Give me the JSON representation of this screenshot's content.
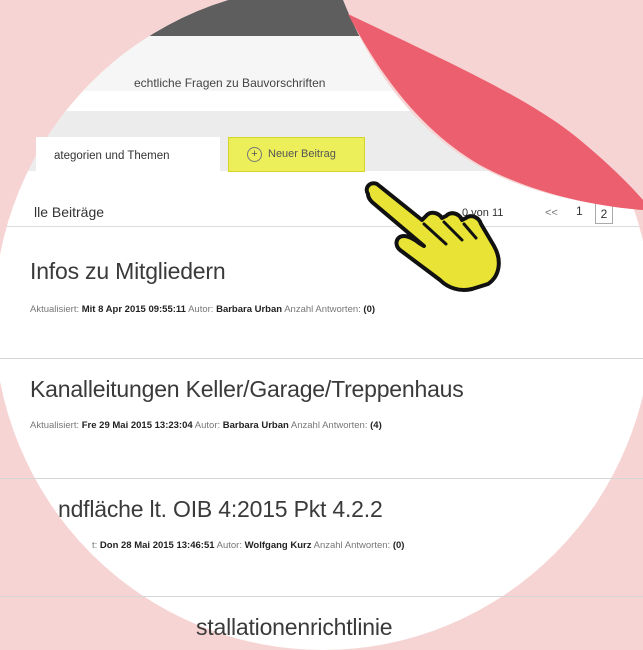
{
  "header": {
    "subtitle": "echtliche Fragen zu Bauvorschriften"
  },
  "toolbar": {
    "categories_label": "ategorien und Themen",
    "new_post_label": "Neuer Beitrag",
    "new_post_icon": "plus-circle-icon"
  },
  "list": {
    "heading": "lle Beiträge",
    "count": "0 von 11",
    "pagination": {
      "prev": "<<",
      "page1": "1",
      "page2": "2"
    }
  },
  "posts": [
    {
      "title": "Infos zu Mitgliedern",
      "updated_label": "Aktualisiert:",
      "updated": "Mit 8 Apr 2015 09:55:11",
      "author_label": "Autor:",
      "author": "Barbara Urban",
      "replies_label": "Anzahl Antworten:",
      "replies": "(0)"
    },
    {
      "title": "Kanalleitungen Keller/Garage/Treppenhaus",
      "updated_label": "Aktualisiert:",
      "updated": "Fre 29 Mai 2015 13:23:04",
      "author_label": "Autor:",
      "author": "Barbara Urban",
      "replies_label": "Anzahl Antworten:",
      "replies": "(4)"
    },
    {
      "title": "ndfläche lt. OIB 4:2015 Pkt 4.2.2",
      "updated_label": "t:",
      "updated": "Don 28 Mai 2015 13:46:51",
      "author_label": "Autor:",
      "author": "Wolfgang Kurz",
      "replies_label": "Anzahl Antworten:",
      "replies": "(0)"
    },
    {
      "title": "stallationenrichtlinie"
    }
  ],
  "decor": {
    "cursor_icon": "hand-pointer-icon",
    "page_curl_color": "#ec5f6e",
    "background_color": "#f7d4d4",
    "cursor_color": "#e8e335"
  }
}
